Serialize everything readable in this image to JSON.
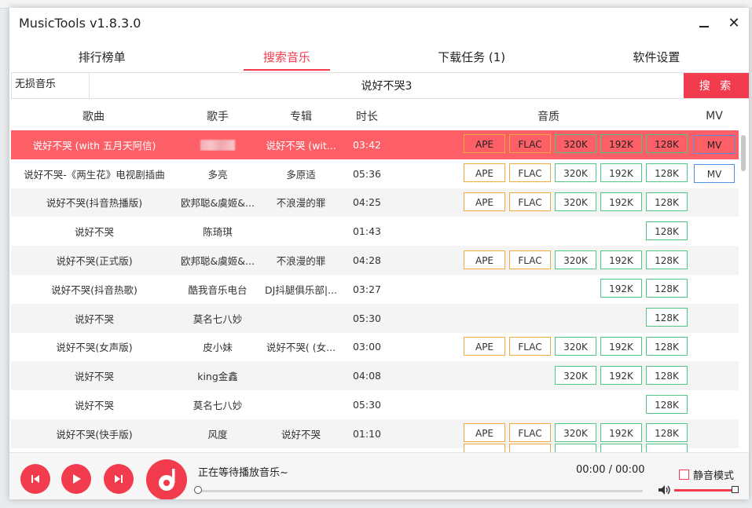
{
  "window": {
    "title": "MusicTools v1.8.3.0"
  },
  "tabs": [
    {
      "label": "排行榜单",
      "active": false
    },
    {
      "label": "搜索音乐",
      "active": true
    },
    {
      "label": "下载任务 (1)",
      "active": false
    },
    {
      "label": "软件设置",
      "active": false
    }
  ],
  "search": {
    "source_label": "无损音乐",
    "query": "说好不哭3",
    "button_label": "搜 索"
  },
  "table": {
    "headers": {
      "song": "歌曲",
      "singer": "歌手",
      "album": "专辑",
      "duration": "时长",
      "quality": "音质",
      "mv": "MV"
    },
    "quality_labels": {
      "ape": "APE",
      "flac": "FLAC",
      "q320": "320K",
      "q192": "192K",
      "q128": "128K"
    },
    "mv_label": "MV",
    "rows": [
      {
        "song": "说好不哭 (with 五月天阿信)",
        "singer": "",
        "album": "说好不哭 (wit...",
        "duration": "03:42"
      },
      {
        "song": "说好不哭-《两生花》电视剧插曲",
        "singer": "多亮",
        "album": "多原适",
        "duration": "05:36"
      },
      {
        "song": "说好不哭(抖音热播版)",
        "singer": "欧邦聪&虞姬&...",
        "album": "不浪漫的罪",
        "duration": "04:25"
      },
      {
        "song": "说好不哭",
        "singer": "陈琦琪",
        "album": "",
        "duration": "01:43"
      },
      {
        "song": "说好不哭(正式版)",
        "singer": "欧邦聪&虞姬&...",
        "album": "不浪漫的罪",
        "duration": "04:28"
      },
      {
        "song": "说好不哭(抖音热歌)",
        "singer": "酷我音乐电台",
        "album": "DJ抖腿俱乐部|...",
        "duration": "03:27"
      },
      {
        "song": "说好不哭",
        "singer": "莫名七八妙",
        "album": "",
        "duration": "05:30"
      },
      {
        "song": "说好不哭(女声版)",
        "singer": "皮小妹",
        "album": "说好不哭( (女...",
        "duration": "03:00"
      },
      {
        "song": "说好不哭",
        "singer": "king金鑫",
        "album": "",
        "duration": "04:08"
      },
      {
        "song": "说好不哭",
        "singer": "莫名七八妙",
        "album": "",
        "duration": "05:30"
      },
      {
        "song": "说好不哭(快手版)",
        "singer": "风度",
        "album": "说好不哭",
        "duration": "01:10"
      }
    ]
  },
  "player": {
    "status": "正在等待播放音乐~",
    "time": "00:00 / 00:00",
    "mute_label": "静音模式",
    "progress": 0,
    "volume": 1.0
  }
}
